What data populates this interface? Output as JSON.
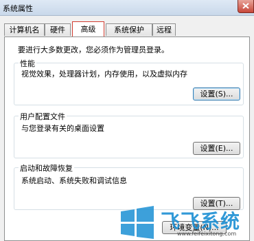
{
  "window": {
    "title": "系统属性"
  },
  "tabs": [
    {
      "label": "计算机名"
    },
    {
      "label": "硬件"
    },
    {
      "label": "高级",
      "active": true
    },
    {
      "label": "系统保护"
    },
    {
      "label": "远程"
    }
  ],
  "notice": "要进行大多数更改，您必须作为管理员登录。",
  "performance": {
    "title": "性能",
    "desc": "视觉效果，处理器计划，内存使用，以及虚拟内存",
    "button": "设置(S)..."
  },
  "profiles": {
    "title": "用户配置文件",
    "desc": "与您登录有关的桌面设置",
    "button": "设置(E)..."
  },
  "startup": {
    "title": "启动和故障恢复",
    "desc": "系统启动、系统失败和调试信息",
    "button": "设置(T)..."
  },
  "env_button": "环境变量(N)...",
  "watermark": {
    "word": "飞飞系统",
    "url": "www.feifeixitong.com"
  },
  "colors": {
    "tab_highlight": "#d23c30",
    "logo_blue": "#1b8fd3"
  }
}
